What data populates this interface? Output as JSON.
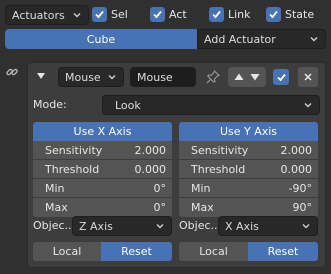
{
  "top": {
    "category_select": "Actuators",
    "filters": [
      {
        "label": "Sel",
        "checked": true
      },
      {
        "label": "Act",
        "checked": true
      },
      {
        "label": "Link",
        "checked": true
      },
      {
        "label": "State",
        "checked": true
      }
    ]
  },
  "object_tab": "Cube",
  "add_actuator": "Add Actuator",
  "actuator": {
    "type": "Mouse",
    "name": "Mouse",
    "mode_label": "Mode:",
    "mode_value": "Look",
    "x_axis": {
      "header": "Use X Axis",
      "sensitivity_label": "Sensitivity",
      "sensitivity": "2.000",
      "threshold_label": "Threshold",
      "threshold": "0.000",
      "min_label": "Min",
      "min": "0°",
      "max_label": "Max",
      "max": "0°",
      "object_label": "Objec...",
      "object_axis": "Z Axis",
      "local_label": "Local",
      "reset_label": "Reset"
    },
    "y_axis": {
      "header": "Use Y Axis",
      "sensitivity_label": "Sensitivity",
      "sensitivity": "2.000",
      "threshold_label": "Threshold",
      "threshold": "0.000",
      "min_label": "Min",
      "min": "-90°",
      "max_label": "Max",
      "max": "90°",
      "object_label": "Objec...",
      "object_axis": "X Axis",
      "local_label": "Local",
      "reset_label": "Reset"
    }
  },
  "colors": {
    "accent": "#4772b3",
    "background": "#303030",
    "panel": "#3d3d3d",
    "field": "#545454"
  }
}
